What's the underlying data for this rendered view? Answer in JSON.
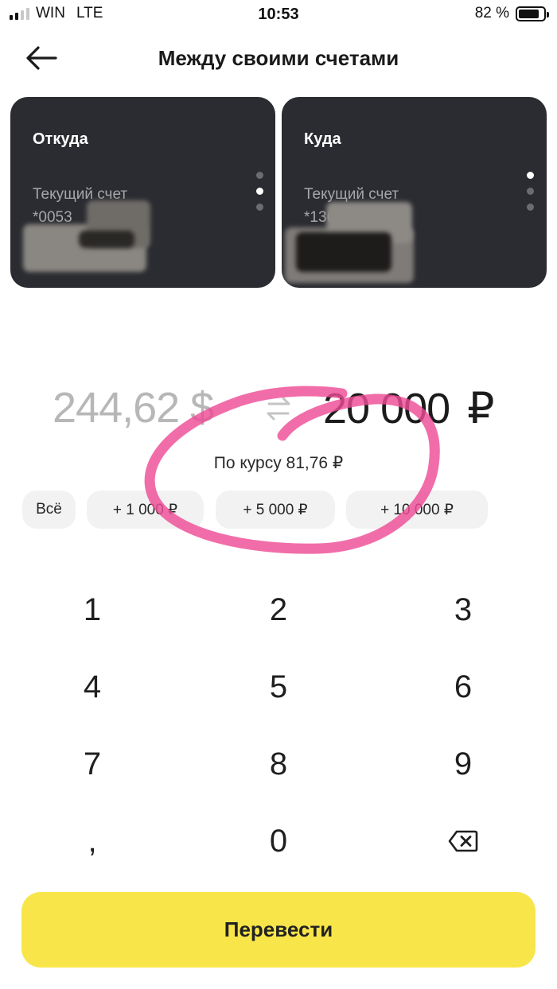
{
  "status_bar": {
    "carrier": "WIN",
    "network": "LTE",
    "time": "10:53",
    "battery_percent": "82 %",
    "battery_level": 0.82,
    "signal_bars": 2
  },
  "header": {
    "title": "Между своими счетами",
    "back_icon": "arrow-left-icon"
  },
  "cards": {
    "from": {
      "label": "Откуда",
      "account_name": "Текущий счет",
      "account_number": "*0053",
      "active_dot": 2
    },
    "to": {
      "label": "Куда",
      "account_name": "Текущий счет",
      "account_number": "*136",
      "active_dot": 1
    }
  },
  "amount": {
    "from_value": "244,62 $",
    "swap_icon": "swap-arrows-icon",
    "to_value": "20 000",
    "to_currency": "₽",
    "rate_text": "По курсу 81,76 ₽"
  },
  "chips": [
    "Всё",
    "+ 1 000 ₽",
    "+ 5 000 ₽",
    "+ 10 000 ₽"
  ],
  "keypad": {
    "keys": [
      "1",
      "2",
      "3",
      "4",
      "5",
      "6",
      "7",
      "8",
      "9",
      ",",
      "0"
    ],
    "backspace_icon": "backspace-icon"
  },
  "submit_label": "Перевести",
  "colors": {
    "card_bg": "#2b2c31",
    "accent_yellow": "#f8e54a",
    "annotation_pink": "#ee4d96"
  }
}
